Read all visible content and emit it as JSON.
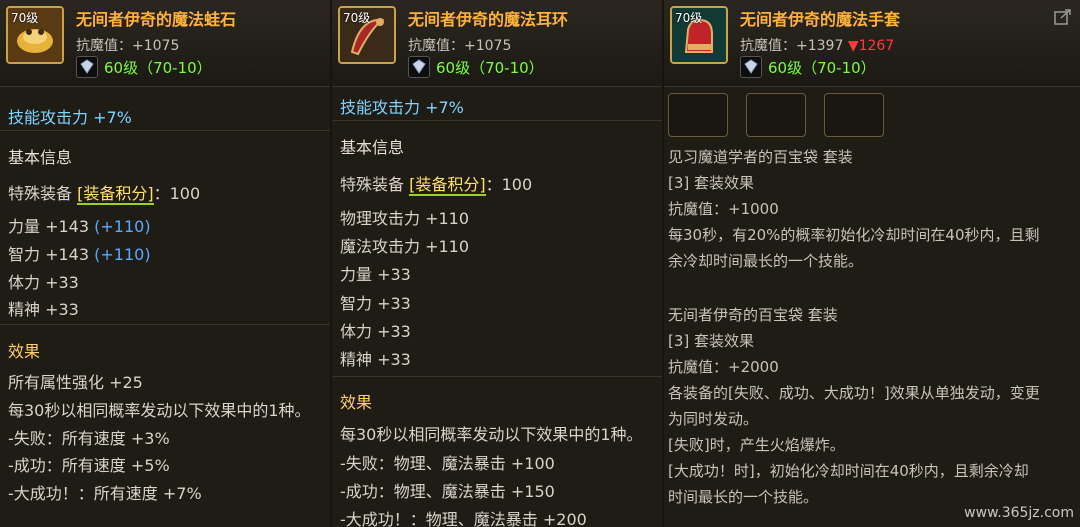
{
  "items": [
    {
      "level": "70级",
      "name": "无间者伊奇的魔法蛙石",
      "resist": "抗魔值：+1075",
      "req": "60级（70-10）",
      "first_line": "技能攻击力 +7%",
      "basic_header": "基本信息",
      "special_label": "特殊装备",
      "special_link": "[装备积分]",
      "special_value": "：100",
      "stats": [
        {
          "text": "力量 +143",
          "bonus": "(+110)"
        },
        {
          "text": "智力 +143",
          "bonus": "(+110)"
        },
        {
          "text": "体力 +33",
          "bonus": ""
        },
        {
          "text": "精神 +33",
          "bonus": ""
        }
      ],
      "effect_header": "效果",
      "effects": [
        "所有属性强化 +25",
        "每30秒以相同概率发动以下效果中的1种。",
        "-失败：所有速度 +3%",
        "-成功：所有速度 +5%",
        "-大成功！：所有速度 +7%"
      ]
    },
    {
      "level": "70级",
      "name": "无间者伊奇的魔法耳环",
      "resist": "抗魔值：+1075",
      "req": "60级（70-10）",
      "first_line": "技能攻击力 +7%",
      "basic_header": "基本信息",
      "special_label": "特殊装备",
      "special_link": "[装备积分]",
      "special_value": "：100",
      "stats": [
        {
          "text": "物理攻击力 +110",
          "bonus": ""
        },
        {
          "text": "魔法攻击力 +110",
          "bonus": ""
        },
        {
          "text": "力量 +33",
          "bonus": ""
        },
        {
          "text": "智力 +33",
          "bonus": ""
        },
        {
          "text": "体力 +33",
          "bonus": ""
        },
        {
          "text": "精神 +33",
          "bonus": ""
        }
      ],
      "effect_header": "效果",
      "effects": [
        "每30秒以相同概率发动以下效果中的1种。",
        "-失败：物理、魔法暴击 +100",
        "-成功：物理、魔法暴击 +150",
        "-大成功！：物理、魔法暴击 +200"
      ]
    },
    {
      "level": "70级",
      "name": "无间者伊奇的魔法手套",
      "resist": "抗魔值：+1397",
      "resist_drop": "▼1267",
      "req": "60级（70-10）",
      "lines": [
        "见习魔道学者的百宝袋  套装",
        "[3] 套装效果",
        "抗魔值：+1000",
        "每30秒，有20%的概率初始化冷却时间在40秒内，且剩",
        "余冷却时间最长的一个技能。",
        "",
        "无间者伊奇的百宝袋  套装",
        "[3] 套装效果",
        "抗魔值：+2000",
        "各装备的[失败、成功、大成功！]效果从单独发动，变更",
        "为同时发动。",
        "[失败]时，产生火焰爆炸。",
        "[大成功！时]，初始化冷却时间在40秒内，且剩余冷却",
        "时间最长的一个技能。"
      ]
    }
  ],
  "watermark": "www.365jz.com",
  "colors": {
    "title": "#ffb23a",
    "req": "#7bff3a",
    "skill": "#7fd4ff",
    "drop": "#ff3a3a",
    "bonus": "#5aa8ff"
  }
}
